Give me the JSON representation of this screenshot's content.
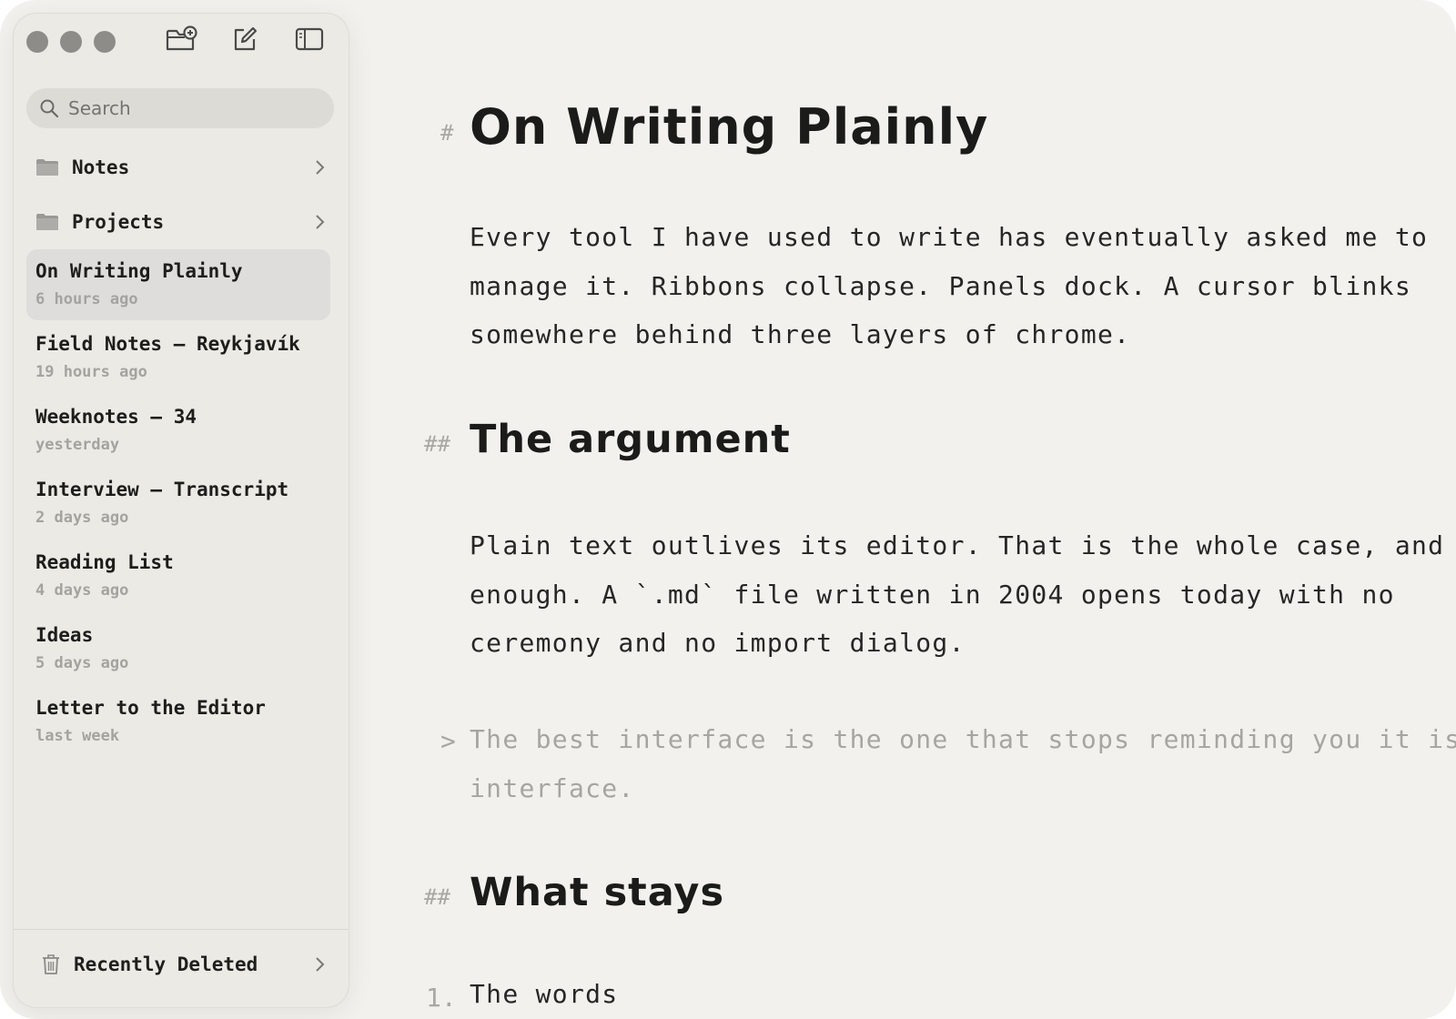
{
  "sidebar": {
    "search_placeholder": "Search",
    "folders": [
      {
        "label": "Notes"
      },
      {
        "label": "Projects"
      }
    ],
    "notes": [
      {
        "title": "On Writing Plainly",
        "time": "6 hours ago",
        "selected": true
      },
      {
        "title": "Field Notes — Reykjavík",
        "time": "19 hours ago"
      },
      {
        "title": "Weeknotes — 34",
        "time": "yesterday"
      },
      {
        "title": "Interview — Transcript",
        "time": "2 days ago"
      },
      {
        "title": "Reading List",
        "time": "4 days ago"
      },
      {
        "title": "Ideas",
        "time": "5 days ago"
      },
      {
        "title": "Letter to the Editor",
        "time": "last week"
      }
    ],
    "recently_deleted": "Recently Deleted"
  },
  "toolbar": {
    "icons": [
      "new-folder-icon",
      "compose-icon",
      "sidebar-toggle-icon"
    ]
  },
  "editor": {
    "h1_marker": "#",
    "title": "On Writing Plainly",
    "intro_lines": [
      "Every tool I have used to write has eventually asked me to",
      "manage it. Ribbons collapse. Panels dock. A cursor blinks",
      "somewhere behind three layers of chrome."
    ],
    "h2_marker": "##",
    "heading_argument": "The argument",
    "argument_lines": [
      "Plain text outlives its editor. That is the whole case, and it is",
      "enough. A `.md` file written in 2004 opens today with no",
      "ceremony and no import dialog."
    ],
    "quote_marker": ">",
    "quote_lines": [
      "The best interface is the one that stops reminding you it is an",
      "interface."
    ],
    "heading_stays": "What stays",
    "list_number": "1.",
    "list_item": "The words"
  },
  "colors": {
    "window_bg": "#f2f1ed",
    "sidebar_bg": "#ebeae5",
    "selected_bg": "#dedddb",
    "text": "#1f1f1d",
    "muted": "#a4a39f"
  }
}
